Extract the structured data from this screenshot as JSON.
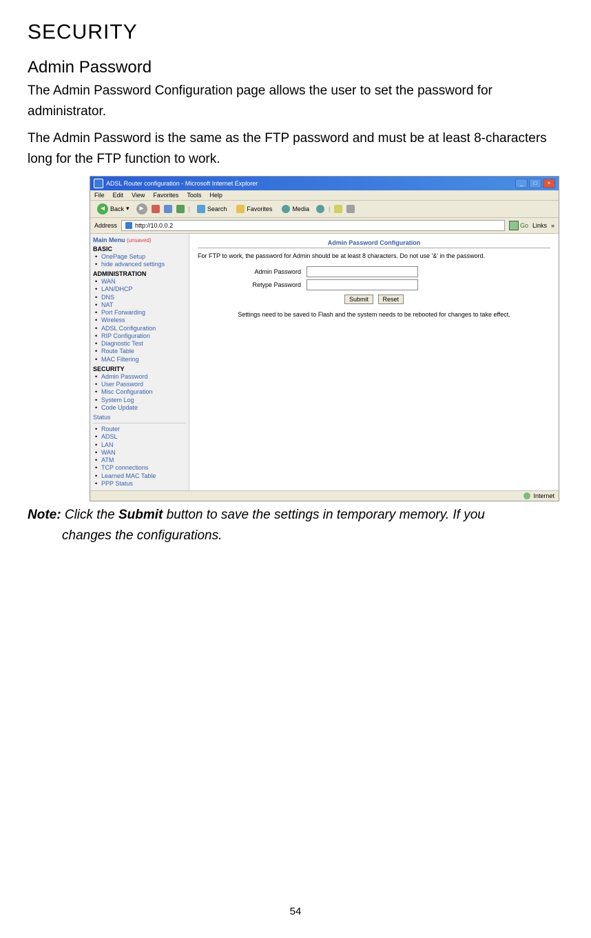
{
  "doc": {
    "heading": "SECURITY",
    "subheading": "Admin Password",
    "para1": "The Admin Password Configuration page allows the user to set the password for administrator.",
    "para2": "The Admin Password is the same as the FTP password and must be at least 8-characters long for the FTP function to work.",
    "note_label": "Note:",
    "note_text1": " Click the ",
    "note_submit": "Submit",
    "note_text2": " button to save the settings in temporary memory. If you",
    "note_text3": "changes the configurations.",
    "page_number": "54"
  },
  "browser": {
    "title": "ADSL Router configuration - Microsoft Internet Explorer",
    "menu": [
      "File",
      "Edit",
      "View",
      "Favorites",
      "Tools",
      "Help"
    ],
    "toolbar": {
      "back": "Back",
      "search": "Search",
      "favorites": "Favorites",
      "media": "Media"
    },
    "address_label": "Address",
    "address_value": "http://10.0.0.2",
    "go": "Go",
    "links": "Links",
    "status": "Internet"
  },
  "sidebar": {
    "title": "Main Menu",
    "unsaved": "(unsaved)",
    "basic": "BASIC",
    "basic_items": [
      "OnePage Setup",
      "hide advanced settings"
    ],
    "admin": "ADMINISTRATION",
    "admin_items": [
      "WAN",
      "LAN/DHCP",
      "DNS",
      "NAT",
      "Port Forwarding",
      "Wireless",
      "ADSL Configuration",
      "RIP Configuration",
      "Diagnostic Test",
      "Route Table",
      "MAC Filtering"
    ],
    "security": "SECURITY",
    "security_items": [
      "Admin Password",
      "User Password",
      "Misc Configuration",
      "System Log",
      "Code Update"
    ],
    "status": "Status",
    "status_items": [
      "Router",
      "ADSL",
      "LAN",
      "WAN",
      "ATM",
      "TCP connections",
      "Learned MAC Table",
      "PPP Status"
    ]
  },
  "panel": {
    "title": "Admin Password Configuration",
    "ftp_note": "For FTP to work, the password for Admin should be at least 8 characters. Do not use '&' in the password.",
    "label_pw": "Admin Password",
    "label_retype": "Retype Password",
    "submit": "Submit",
    "reset": "Reset",
    "save_note": "Settings need to be saved to Flash and the system needs to be rebooted for changes to take effect."
  }
}
